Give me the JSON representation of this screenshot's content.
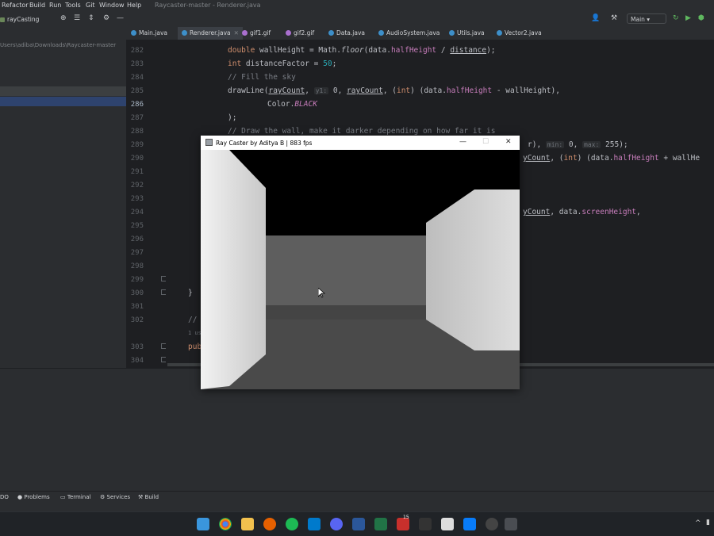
{
  "menu": [
    "Refactor",
    "Build",
    "Run",
    "Tools",
    "Git",
    "Window",
    "Help"
  ],
  "window_title": "Raycaster-master - Renderer.java",
  "breadcrumb": "rayCasting",
  "branch": "Main",
  "project_path": "Users\\adiba\\Downloads\\Raycaster-master",
  "tabs": [
    {
      "label": "Main.java",
      "active": false
    },
    {
      "label": "Renderer.java",
      "active": true
    },
    {
      "label": "gif1.gif",
      "active": false
    },
    {
      "label": "gif2.gif",
      "active": false
    },
    {
      "label": "Data.java",
      "active": false
    },
    {
      "label": "AudioSystem.java",
      "active": false
    },
    {
      "label": "Utils.java",
      "active": false
    },
    {
      "label": "Vector2.java",
      "active": false
    }
  ],
  "line_numbers": [
    "282",
    "283",
    "284",
    "285",
    "286",
    "287",
    "288",
    "289",
    "290",
    "291",
    "292",
    "293",
    "294",
    "295",
    "296",
    "297",
    "298",
    "299",
    "300",
    "301",
    "302",
    "",
    "303",
    "304"
  ],
  "current_line": "286",
  "code": {
    "l282_a": "double ",
    "l282_b": "wallHeight = Math.",
    "l282_c": "floor",
    "l282_d": "(data.",
    "l282_e": "halfHeight",
    "l282_f": " / ",
    "l282_g": "distance",
    "l282_h": ");",
    "l283_a": "int ",
    "l283_b": "distanceFactor = ",
    "l283_c": "50",
    "l283_d": ";",
    "l284": "// Fill the sky",
    "l285_a": "drawLine(",
    "l285_b": "rayCount",
    "l285_c": ", ",
    "l285_hint": "y1:",
    "l285_d": " 0, ",
    "l285_e": "rayCount",
    "l285_f": ", (",
    "l285_g": "int",
    "l285_h": ") (data.",
    "l285_i": "halfHeight",
    "l285_j": " - wallHeight),",
    "l286_a": "Color.",
    "l286_b": "BLACK",
    "l287": ");",
    "l288": "// Draw the wall, make it darker depending on how far it is",
    "l289_a": "r), ",
    "l289_hint1": "min:",
    "l289_b": " 0, ",
    "l289_hint2": "max:",
    "l289_c": " 255);",
    "l290_a": "yCount",
    "l290_b": ", (",
    "l290_c": "int",
    "l290_d": ") (data.",
    "l290_e": "halfHeight",
    "l290_f": " + wallHe",
    "l294_a": "yCount",
    "l294_b": ", data.",
    "l294_c": "screenHeight",
    "l294_d": ",",
    "l300": "}",
    "l302": "//",
    "usages": "1 us",
    "l303": "pub"
  },
  "app_window": {
    "title": "Ray Caster by Aditya B | 883 fps",
    "minimize": "—",
    "maximize": "☐",
    "close": "✕"
  },
  "tool_windows": [
    "DO",
    "Problems",
    "Terminal",
    "Services",
    "Build"
  ],
  "taskbar_badge": "15",
  "colors": {
    "accent": "#4a88c7",
    "editor_bg": "#1e1f22",
    "ide_bg": "#2b2d30",
    "wall_light": "#d6d6d6",
    "floor": "#4a4a4a",
    "sky": "#000000"
  }
}
